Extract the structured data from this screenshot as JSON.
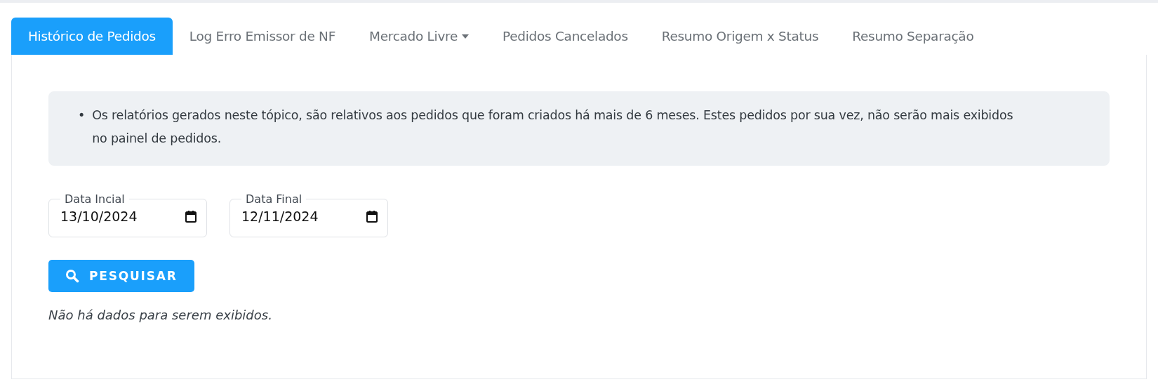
{
  "tabs": [
    {
      "label": "Histórico de Pedidos",
      "selected": true,
      "dropdown": false
    },
    {
      "label": "Log Erro Emissor de NF",
      "selected": false,
      "dropdown": false
    },
    {
      "label": "Mercado Livre",
      "selected": false,
      "dropdown": true
    },
    {
      "label": "Pedidos Cancelados",
      "selected": false,
      "dropdown": false
    },
    {
      "label": "Resumo Origem x Status",
      "selected": false,
      "dropdown": false
    },
    {
      "label": "Resumo Separação",
      "selected": false,
      "dropdown": false
    }
  ],
  "notice": {
    "marker": "•",
    "items": [
      "Os relatórios gerados neste tópico, são relativos aos pedidos que foram criados há mais de 6 meses. Estes pedidos por sua vez, não serão mais exibidos no painel de pedidos."
    ]
  },
  "filters": [
    {
      "label": "Data Incial",
      "value": "13/10/2024"
    },
    {
      "label": "Data Final",
      "value": "12/11/2024"
    }
  ],
  "search_button": {
    "label": "PESQUISAR"
  },
  "empty_message": "Não há dados para serem exibidos."
}
